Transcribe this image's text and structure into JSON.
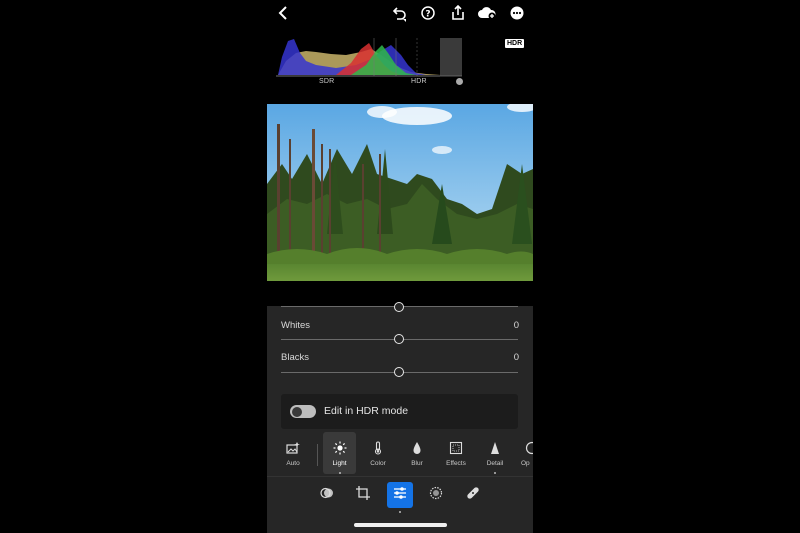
{
  "topbar": {
    "icons": [
      "back-chevron-icon",
      "undo-icon",
      "help-icon",
      "share-icon",
      "cloud-sync-icon",
      "more-icon"
    ]
  },
  "histogram": {
    "sdr_label": "SDR",
    "hdr_label": "HDR",
    "hdr_badge": "HDR",
    "colors": {
      "blue": "#3a3ad8",
      "red": "#e03030",
      "green": "#2fb84a",
      "yellow": "#d8c070"
    }
  },
  "sliders": [
    {
      "label": "Whites",
      "value": "0",
      "position": 0.5
    },
    {
      "label": "Blacks",
      "value": "0",
      "position": 0.5
    }
  ],
  "hdr_mode": {
    "label": "Edit in HDR mode",
    "enabled": true
  },
  "tools": [
    {
      "label": "Auto",
      "icon": "auto-image-icon"
    },
    {
      "label": "Light",
      "icon": "sun-icon",
      "active": true
    },
    {
      "label": "Color",
      "icon": "thermometer-icon"
    },
    {
      "label": "Blur",
      "icon": "droplet-icon"
    },
    {
      "label": "Effects",
      "icon": "effects-icon"
    },
    {
      "label": "Detail",
      "icon": "triangle-icon"
    },
    {
      "label": "Op",
      "icon": "optics-icon"
    }
  ],
  "bottom_nav": {
    "icons": [
      "presets-icon",
      "crop-icon",
      "adjust-sliders-icon",
      "masking-icon",
      "healing-icon"
    ],
    "active": "adjust-sliders-icon",
    "accent": "#1473e6"
  }
}
